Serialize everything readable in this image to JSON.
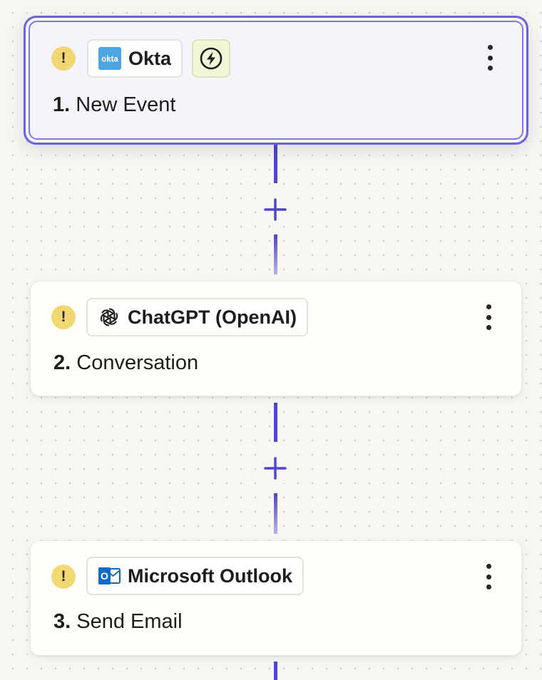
{
  "steps": [
    {
      "number": "1.",
      "title": "New Event",
      "app": "Okta",
      "app_icon": "okta-logo-icon",
      "trigger_icon": "lightning-bolt-icon",
      "status_icon": "warning-icon",
      "status_glyph": "!",
      "selected": true
    },
    {
      "number": "2.",
      "title": "Conversation",
      "app": "ChatGPT (OpenAI)",
      "app_icon": "openai-logo-icon",
      "status_icon": "warning-icon",
      "status_glyph": "!"
    },
    {
      "number": "3.",
      "title": "Send Email",
      "app": "Microsoft Outlook",
      "app_icon": "outlook-logo-icon",
      "status_icon": "warning-icon",
      "status_glyph": "!"
    }
  ],
  "okta_logo_text": "okta",
  "outlook_logo_letter": "O",
  "colors": {
    "accent": "#4f46c8",
    "selected_border": "#6a62d8",
    "warning": "#f2d872",
    "trigger_bg": "#f1f7d6",
    "okta_blue": "#4aa5e0",
    "outlook_blue": "#0f6cc4",
    "canvas": "#f7f6f2"
  }
}
